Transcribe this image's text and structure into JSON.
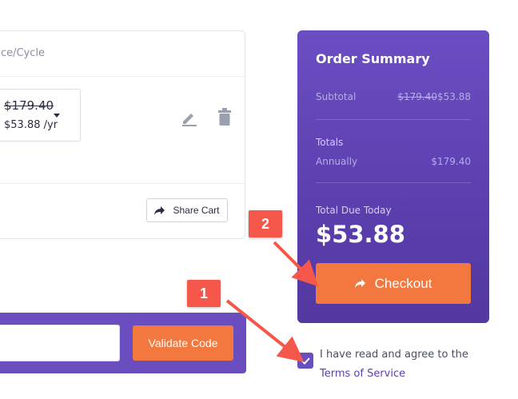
{
  "cart": {
    "column_label": "ce/Cycle",
    "item": {
      "old_price": "$179.40",
      "new_price": "$53.88 /yr"
    },
    "share_label": "Share Cart"
  },
  "promo": {
    "input_value": "",
    "validate_label": "Validate Code"
  },
  "summary": {
    "title": "Order Summary",
    "subtotal_label": "Subtotal",
    "subtotal_old": "$179.40",
    "subtotal_new": "$53.88",
    "totals_label": "Totals",
    "annually_label": "Annually",
    "annually_value": "$179.40",
    "due_label": "Total Due Today",
    "due_amount": "$53.88",
    "checkout_label": "Checkout"
  },
  "terms": {
    "text": "I have read and agree to the",
    "link": "Terms of Service",
    "checked": true
  },
  "annotations": {
    "badge_1": "1",
    "badge_2": "2"
  },
  "colors": {
    "accent_purple": "#6a4dbf",
    "accent_orange": "#f2783f",
    "annotation_red": "#f5574a"
  },
  "icons": [
    "edit-icon",
    "trash-icon",
    "share-icon",
    "check-icon"
  ]
}
